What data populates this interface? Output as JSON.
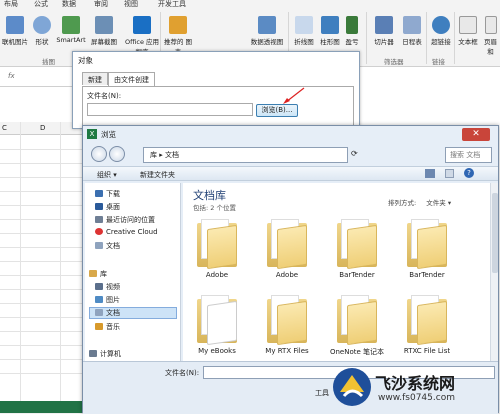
{
  "ribbon": {
    "tabs": [
      "布局",
      "公式",
      "数据",
      "审阅",
      "视图",
      "开发工具"
    ],
    "buttons": [
      {
        "label": "联机图片",
        "icon": "online-picture-icon"
      },
      {
        "label": "形状",
        "icon": "shapes-icon"
      },
      {
        "label": "SmartArt",
        "icon": "smartart-icon"
      },
      {
        "label": "屏幕截图",
        "icon": "screenshot-icon"
      },
      {
        "label": "Office 应用程序",
        "icon": "office-store-icon"
      },
      {
        "label": "推荐的 图表",
        "icon": "recommended-charts-icon"
      },
      {
        "label": "数据透视图",
        "icon": "pivot-chart-icon"
      },
      {
        "label": "折线图",
        "icon": "line-sparkline-icon"
      },
      {
        "label": "柱形图",
        "icon": "column-sparkline-icon"
      },
      {
        "label": "盈亏",
        "icon": "winloss-icon"
      },
      {
        "label": "切片器",
        "icon": "slicer-icon"
      },
      {
        "label": "日程表",
        "icon": "timeline-icon"
      },
      {
        "label": "超链接",
        "icon": "hyperlink-icon"
      },
      {
        "label": "文本框",
        "icon": "textbox-icon"
      },
      {
        "label": "页眉和",
        "icon": "header-icon"
      }
    ],
    "groups": [
      "插图",
      "筛选器",
      "链接"
    ]
  },
  "sheet": {
    "fx_label": "fx",
    "columns": [
      "C",
      "D"
    ]
  },
  "object_dialog": {
    "title": "对象",
    "tabs": [
      "新建",
      "由文件创建"
    ],
    "filename_label": "文件名(N):",
    "browse_label": "浏览(B)..."
  },
  "browse_dialog": {
    "title": "浏览",
    "address": [
      "库",
      "文档"
    ],
    "search_placeholder": "搜索 文档",
    "toolbar": {
      "organize": "组织 ▾",
      "new_folder": "新建文件夹"
    },
    "nav": {
      "favorites": [
        {
          "label": "下载",
          "icon": "download-folder-icon",
          "color": "#3b6fb0"
        },
        {
          "label": "桌面",
          "icon": "desktop-icon",
          "color": "#2a5a9a"
        },
        {
          "label": "最近访问的位置",
          "icon": "recent-places-icon",
          "color": "#6f7f95"
        },
        {
          "label": "Creative Cloud",
          "icon": "creative-cloud-icon",
          "color": "#d33"
        },
        {
          "label": "文档",
          "icon": "documents-icon",
          "color": "#8fa3be"
        }
      ],
      "libraries_label": "库",
      "libraries": [
        {
          "label": "视频",
          "icon": "videos-icon",
          "color": "#5b6f8c"
        },
        {
          "label": "图片",
          "icon": "pictures-icon",
          "color": "#4f8bc4"
        },
        {
          "label": "文档",
          "icon": "documents-icon",
          "color": "#8fa3be"
        },
        {
          "label": "音乐",
          "icon": "music-icon",
          "color": "#d89a2b"
        }
      ],
      "computer_label": "计算机"
    },
    "library": {
      "title": "文档库",
      "subtitle": "包括: 2 个位置",
      "arrange_label": "排列方式:",
      "arrange_value": "文件夹 ▾"
    },
    "folders": [
      "Adobe",
      "Adobe",
      "BarTender",
      "BarTender",
      "My eBooks",
      "My RTX Files",
      "OneNote 笔记本",
      "RTXC File List"
    ],
    "filename_label": "文件名(N):",
    "tools_label": "工具"
  },
  "watermark": {
    "brand_text": "飞沙系统网",
    "url_text": "www.fs0745.com"
  }
}
